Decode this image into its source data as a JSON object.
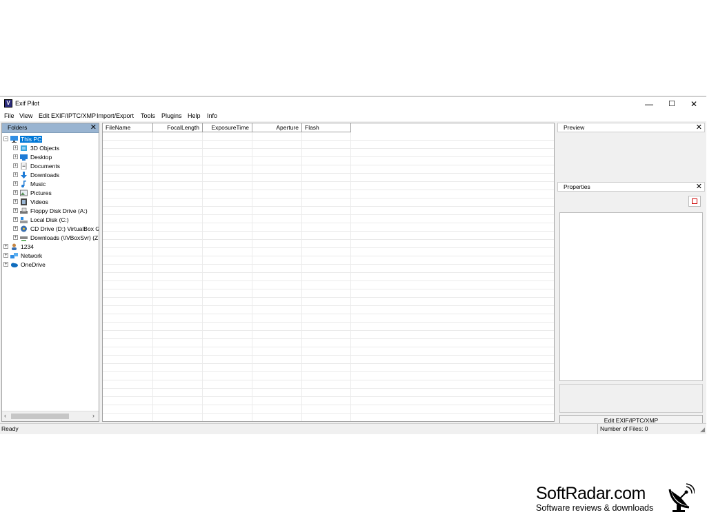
{
  "window": {
    "title": "Exif Pilot",
    "controls": {
      "minimize": "—",
      "maximize": "☐",
      "close": "✕"
    }
  },
  "menu": [
    "File",
    "View",
    "Edit EXIF/IPTC/XMP",
    "Import/Export",
    "Tools",
    "Plugins",
    "Help",
    "Info"
  ],
  "folders": {
    "header": "Folders",
    "tree": [
      {
        "label": "This PC",
        "level": 0,
        "expander": "−",
        "icon": "computer-icon",
        "selected": true
      },
      {
        "label": "3D Objects",
        "level": 1,
        "expander": "+",
        "icon": "3d-objects-icon"
      },
      {
        "label": "Desktop",
        "level": 1,
        "expander": "+",
        "icon": "desktop-icon"
      },
      {
        "label": "Documents",
        "level": 1,
        "expander": "+",
        "icon": "documents-icon"
      },
      {
        "label": "Downloads",
        "level": 1,
        "expander": "+",
        "icon": "download-arrow-icon"
      },
      {
        "label": "Music",
        "level": 1,
        "expander": "+",
        "icon": "music-note-icon"
      },
      {
        "label": "Pictures",
        "level": 1,
        "expander": "+",
        "icon": "pictures-icon"
      },
      {
        "label": "Videos",
        "level": 1,
        "expander": "+",
        "icon": "videos-icon"
      },
      {
        "label": "Floppy Disk Drive (A:)",
        "level": 1,
        "expander": "+",
        "icon": "floppy-icon"
      },
      {
        "label": "Local Disk (C:)",
        "level": 1,
        "expander": "+",
        "icon": "local-disk-icon"
      },
      {
        "label": "CD Drive (D:) VirtualBox G",
        "level": 1,
        "expander": "+",
        "icon": "cd-drive-icon"
      },
      {
        "label": "Downloads (\\\\VBoxSvr) (Z",
        "level": 1,
        "expander": "+",
        "icon": "network-drive-icon"
      },
      {
        "label": "1234",
        "level": 0,
        "expander": "+",
        "icon": "user-icon"
      },
      {
        "label": "Network",
        "level": 0,
        "expander": "+",
        "icon": "network-icon"
      },
      {
        "label": "OneDrive",
        "level": 0,
        "expander": "+",
        "icon": "onedrive-icon"
      }
    ],
    "scroll_left": "‹",
    "scroll_right": "›"
  },
  "file_list": {
    "columns": [
      {
        "label": "FileName",
        "align": "left"
      },
      {
        "label": "FocalLength",
        "align": "right"
      },
      {
        "label": "ExposureTime",
        "align": "right"
      },
      {
        "label": "Aperture",
        "align": "right"
      },
      {
        "label": "Flash",
        "align": "left"
      }
    ],
    "rows": []
  },
  "preview": {
    "header": "Preview"
  },
  "properties": {
    "header": "Properties",
    "edit_button": "Edit EXIF/IPTC/XMP"
  },
  "panel_close": "✕",
  "status": {
    "left": "Ready",
    "right": "Number of Files: 0"
  },
  "watermark": {
    "name": "SoftRadar.com",
    "tagline": "Software reviews & downloads"
  },
  "colors": {
    "selection": "#0078d7",
    "folders_header": "#99b4d1"
  }
}
